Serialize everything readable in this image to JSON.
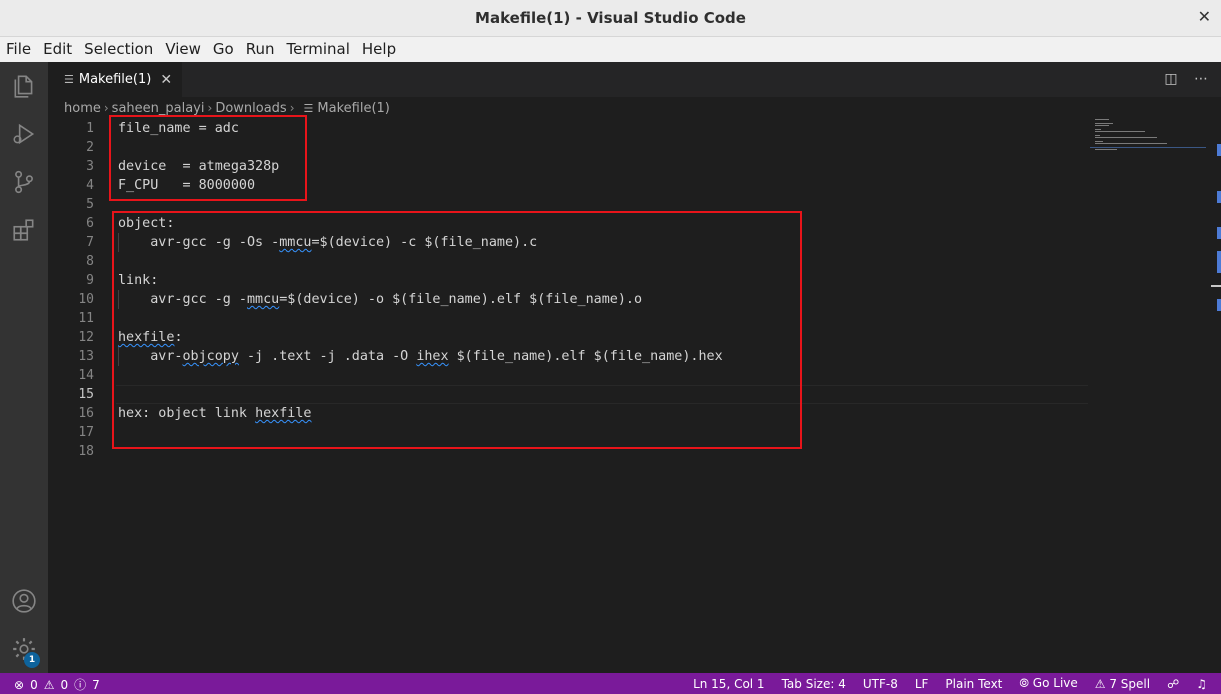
{
  "window": {
    "title": "Makefile(1) - Visual Studio Code",
    "close_glyph": "✕"
  },
  "menu": [
    "File",
    "Edit",
    "Selection",
    "View",
    "Go",
    "Run",
    "Terminal",
    "Help"
  ],
  "tab": {
    "label": "Makefile(1)",
    "close_glyph": "✕",
    "icon": "lines-icon"
  },
  "tab_actions": {
    "split_glyph": "◫",
    "more_glyph": "⋯"
  },
  "breadcrumb": [
    "home",
    "saheen_palayi",
    "Downloads",
    "Makefile(1)"
  ],
  "editor": {
    "line_numbers": [
      "1",
      "2",
      "3",
      "4",
      "5",
      "6",
      "7",
      "8",
      "9",
      "10",
      "11",
      "12",
      "13",
      "14",
      "15",
      "16",
      "17",
      "18"
    ],
    "lines": [
      "file_name = adc",
      "",
      "device  = atmega328p",
      "F_CPU   = 8000000",
      "",
      "object:",
      "    avr-gcc -g -Os -mmcu=$(device) -c $(file_name).c",
      "",
      "link:",
      "    avr-gcc -g -mmcu=$(device) -o $(file_name).elf $(file_name).o",
      "",
      "hexfile:",
      "    avr-objcopy -j .text -j .data -O ihex $(file_name).elf $(file_name).hex",
      "",
      "",
      "hex: object link hexfile",
      "",
      ""
    ],
    "active_line": 15,
    "squiggle_words": [
      "atmega",
      "mmcu",
      "objcopy",
      "ihex",
      "hexfile"
    ]
  },
  "status": {
    "errors": "0",
    "warnings": "0",
    "info": "7",
    "cursor": "Ln 15, Col 1",
    "tab_size": "Tab Size: 4",
    "encoding": "UTF-8",
    "eol": "LF",
    "language": "Plain Text",
    "go_live": "Go Live",
    "spell": "7 Spell"
  },
  "activity": {
    "settings_badge": "1"
  },
  "colors": {
    "status_bar": "#7a1a9a",
    "highlight_box": "#e8141a",
    "squiggle": "#3794ff"
  }
}
